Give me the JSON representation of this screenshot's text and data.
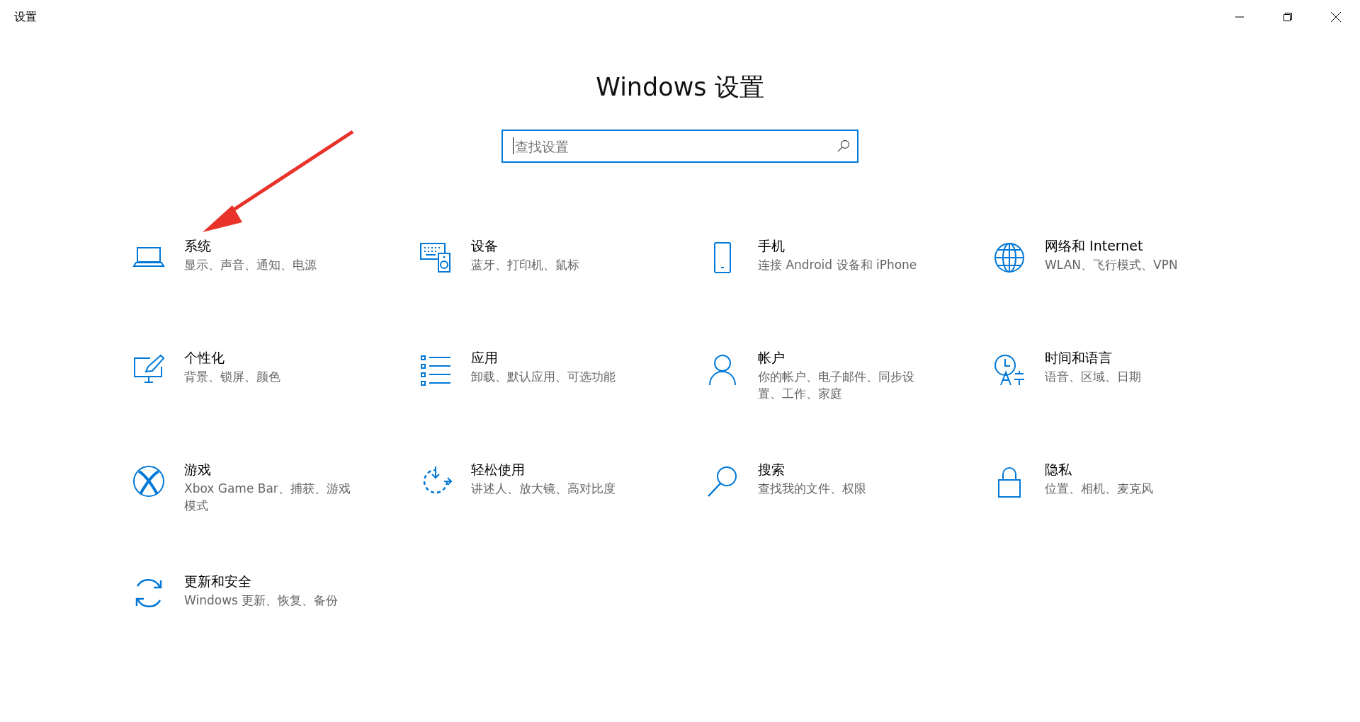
{
  "window": {
    "title": "设置"
  },
  "heading": "Windows 设置",
  "search": {
    "placeholder": "查找设置"
  },
  "tiles": [
    {
      "title": "系统",
      "description": "显示、声音、通知、电源"
    },
    {
      "title": "设备",
      "description": "蓝牙、打印机、鼠标"
    },
    {
      "title": "手机",
      "description": "连接 Android 设备和 iPhone"
    },
    {
      "title": "网络和 Internet",
      "description": "WLAN、飞行模式、VPN"
    },
    {
      "title": "个性化",
      "description": "背景、锁屏、颜色"
    },
    {
      "title": "应用",
      "description": "卸载、默认应用、可选功能"
    },
    {
      "title": "帐户",
      "description": "你的帐户、电子邮件、同步设置、工作、家庭"
    },
    {
      "title": "时间和语言",
      "description": "语音、区域、日期"
    },
    {
      "title": "游戏",
      "description": "Xbox Game Bar、捕获、游戏模式"
    },
    {
      "title": "轻松使用",
      "description": "讲述人、放大镜、高对比度"
    },
    {
      "title": "搜索",
      "description": "查找我的文件、权限"
    },
    {
      "title": "隐私",
      "description": "位置、相机、麦克风"
    },
    {
      "title": "更新和安全",
      "description": "Windows 更新、恢复、备份"
    }
  ]
}
